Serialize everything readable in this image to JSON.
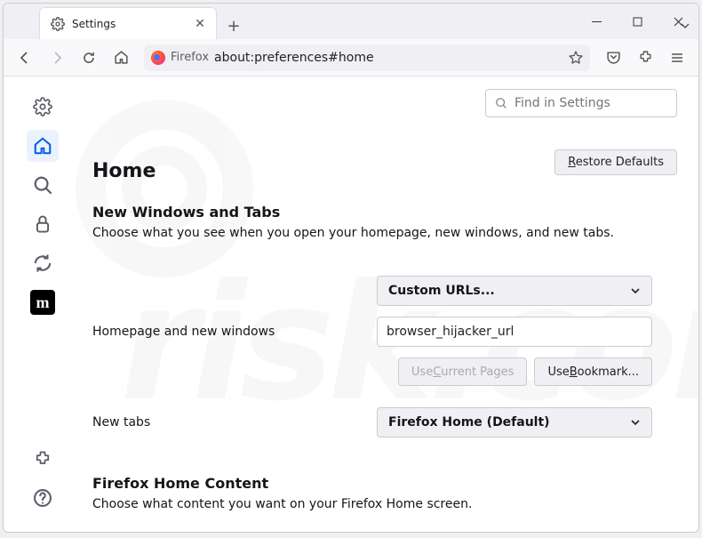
{
  "window": {
    "tab_title": "Settings"
  },
  "urlbar": {
    "brand": "Firefox",
    "url": "about:preferences#home"
  },
  "search": {
    "placeholder": "Find in Settings"
  },
  "page": {
    "title": "Home",
    "restore": "Restore Defaults"
  },
  "section1": {
    "heading": "New Windows and Tabs",
    "desc": "Choose what you see when you open your homepage, new windows, and new tabs."
  },
  "homepage": {
    "label": "Homepage and new windows",
    "dropdown": "Custom URLs...",
    "value": "browser_hijacker_url",
    "use_current": "Use Current Pages",
    "use_bookmark": "Use Bookmark..."
  },
  "newtabs": {
    "label": "New tabs",
    "dropdown": "Firefox Home (Default)"
  },
  "section2": {
    "heading": "Firefox Home Content",
    "desc": "Choose what content you want on your Firefox Home screen."
  }
}
